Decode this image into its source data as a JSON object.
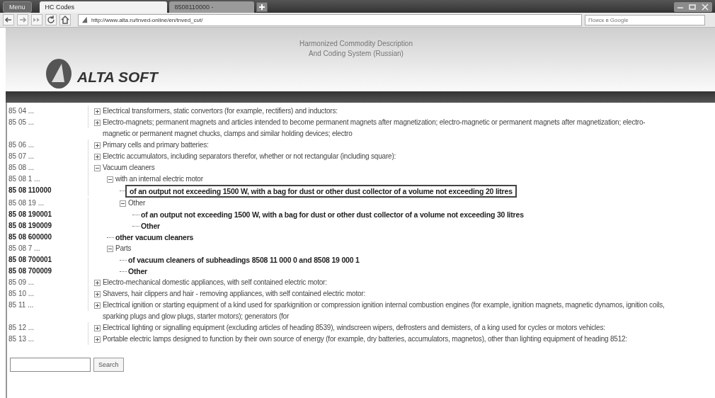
{
  "browser": {
    "menu_label": "Menu",
    "tabs": [
      {
        "label": "HC Codes",
        "selected": true
      },
      {
        "label": "8508110000 -",
        "selected": false
      }
    ],
    "address": "http://www.alta.ru/tnved-online/en/tnved_cut/",
    "search_placeholder": "Поиск в Google"
  },
  "header": {
    "logo_text": "ALTA SOFT",
    "title_lines": [
      "Harmonized Commodity Description",
      "And Coding System (Russian)"
    ]
  },
  "tree": [
    {
      "code": "85 04 ...",
      "label": "Electrical transformers, static convertors (for example, rectifiers) and inductors:",
      "kind": "group",
      "expanded": false,
      "selected": false
    },
    {
      "code": "85 05 ...",
      "label": "Electro-magnets; permanent magnets and articles intended to become permanent magnets after magnetization; electro-magnetic or permanent magnets after magnetization; electro-magnetic or permanent magnet chucks, clamps and similar holding devices; electro",
      "kind": "group",
      "expanded": false,
      "selected": false
    },
    {
      "code": "85 06 ...",
      "label": "Primary cells and primary batteries:",
      "kind": "group",
      "expanded": false,
      "selected": false
    },
    {
      "code": "85 07 ...",
      "label": "Electric accumulators, including separators therefor, whether or not rectangular (including square):",
      "kind": "group",
      "expanded": false,
      "selected": false
    },
    {
      "code": "85 08 ...",
      "label": "Vacuum cleaners",
      "kind": "group",
      "expanded": true,
      "selected": false,
      "children": [
        {
          "code": "85 08 1 ...",
          "label": "with an internal electric motor",
          "kind": "group",
          "expanded": true,
          "selected": false,
          "children": [
            {
              "code": "85 08 110000",
              "label": "of an output not exceeding 1500 W, with a bag for dust or other dust collector of a volume not exceeding 20 litres",
              "kind": "leaf",
              "selected": true
            },
            {
              "code": "85 08 19 ...",
              "label": "Other",
              "kind": "group",
              "expanded": true,
              "selected": false,
              "children": [
                {
                  "code": "85 08 190001",
                  "label": "of an output not exceeding 1500 W, with a bag for dust or other dust collector of a volume not exceeding 30 litres",
                  "kind": "leaf",
                  "selected": false
                },
                {
                  "code": "85 08 190009",
                  "label": "Other",
                  "kind": "leaf",
                  "selected": false
                }
              ]
            }
          ]
        },
        {
          "code": "85 08 600000",
          "label": "other vacuum cleaners",
          "kind": "leaf",
          "selected": false
        },
        {
          "code": "85 08 7 ...",
          "label": "Parts",
          "kind": "group",
          "expanded": true,
          "selected": false,
          "children": [
            {
              "code": "85 08 700001",
              "label": "of vacuum cleaners of subheadings 8508 11 000 0 and 8508 19 000 1",
              "kind": "leaf",
              "selected": false
            },
            {
              "code": "85 08 700009",
              "label": "Other",
              "kind": "leaf",
              "selected": false
            }
          ]
        }
      ]
    },
    {
      "code": "85 09 ...",
      "label": "Electro-mechanical domestic appliances, with self contained electric motor:",
      "kind": "group",
      "expanded": false,
      "selected": false
    },
    {
      "code": "85 10 ...",
      "label": "Shavers, hair clippers and hair - removing appliances, with self contained electric motor:",
      "kind": "group",
      "expanded": false,
      "selected": false
    },
    {
      "code": "85 11 ...",
      "label": "Electrical ignition or starting equipment of a kind used for sparkignition or compression ignition internal combustion engines (for example, ignition magnets, magnetic dynamos, ignition coils, sparking plugs and glow plugs, starter motors); generators (for",
      "kind": "group",
      "expanded": false,
      "selected": false
    },
    {
      "code": "85 12 ...",
      "label": "Electrical lighting or signalling equipment (excluding articles of heading 8539), windscreen wipers, defrosters and demisters, of a king used for cycles or motors vehicles:",
      "kind": "group",
      "expanded": false,
      "selected": false
    },
    {
      "code": "85 13 ...",
      "label": "Portable electric lamps designed to function by their own source of energy (for example, dry batteries, accumulators, magnetos), other than lighting equipment of heading 8512:",
      "kind": "group",
      "expanded": false,
      "selected": false
    }
  ],
  "search": {
    "button": "Search"
  }
}
